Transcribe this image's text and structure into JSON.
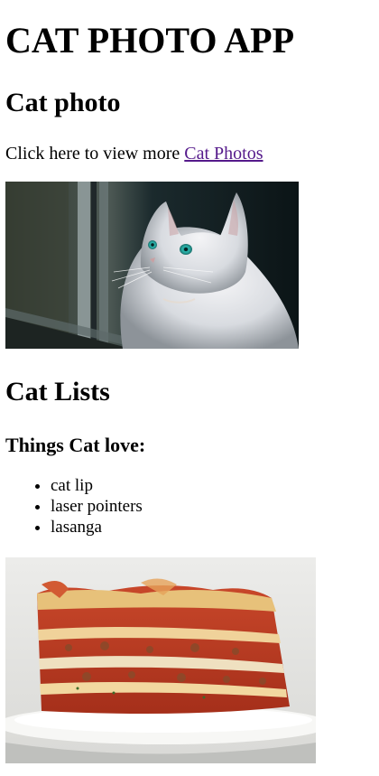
{
  "page": {
    "title": "CAT PHOTO APP"
  },
  "photo_section": {
    "heading": "Cat photo",
    "intro_text": "Click here to view more ",
    "link_text": "Cat Photos",
    "image_subject": "white-fluffy-cat-by-window"
  },
  "lists_section": {
    "heading": "Cat Lists",
    "subheading": "Things Cat love:",
    "items": [
      "cat lip",
      "laser pointers",
      "lasanga"
    ],
    "image_subject": "lasagna-on-plate"
  },
  "colors": {
    "link": "#551a8b",
    "text": "#000000",
    "background": "#ffffff"
  }
}
